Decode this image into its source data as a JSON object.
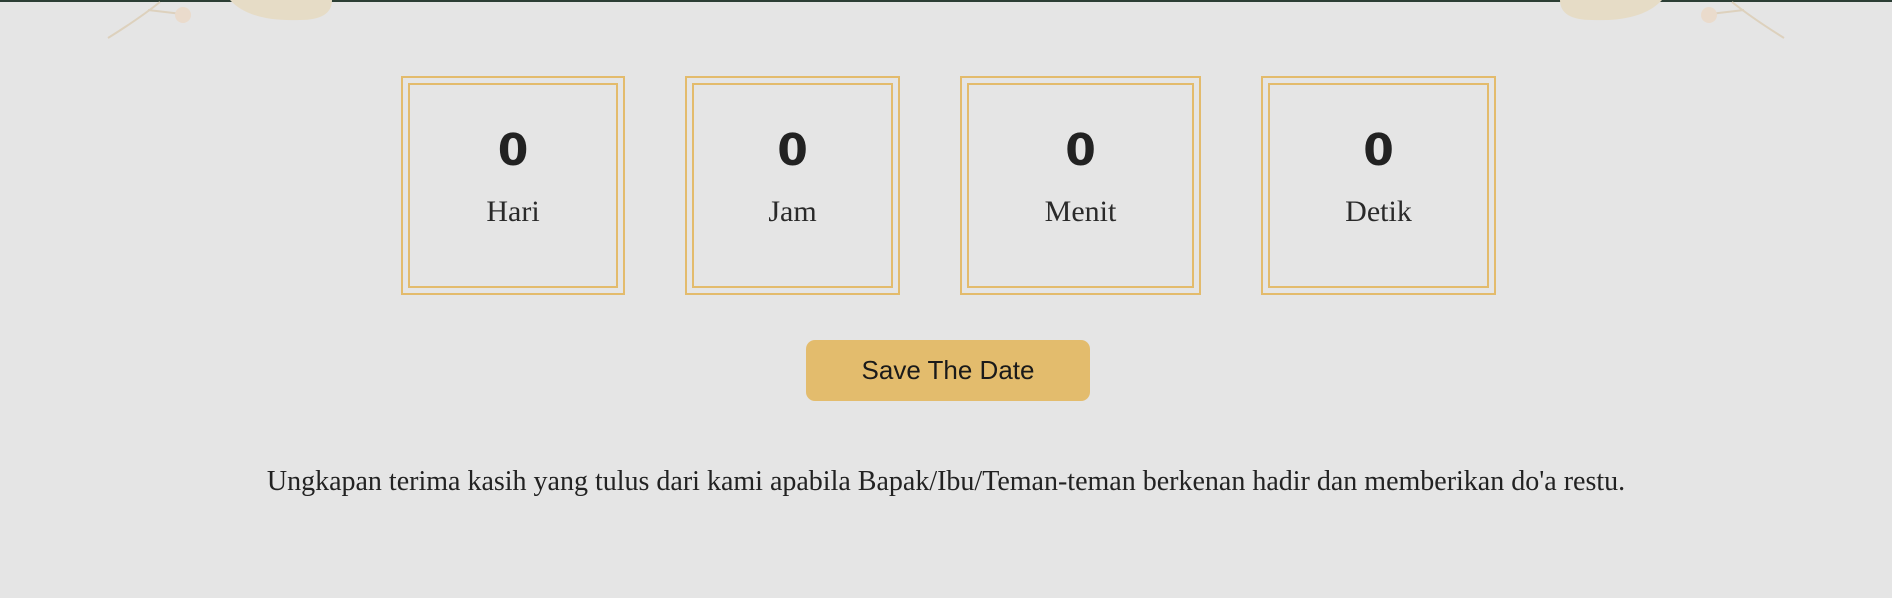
{
  "countdown": {
    "days": {
      "value": "0",
      "label": "Hari"
    },
    "hours": {
      "value": "0",
      "label": "Jam"
    },
    "minutes": {
      "value": "0",
      "label": "Menit"
    },
    "seconds": {
      "value": "0",
      "label": "Detik"
    }
  },
  "save_button_label": "Save The Date",
  "message": "Ungkapan terima kasih yang tulus dari kami apabila Bapak/Ibu/Teman-teman berkenan hadir dan memberikan do'a restu.",
  "colors": {
    "background": "#e5e5e5",
    "accent_gold": "#e3bb6c",
    "text": "#222222"
  }
}
